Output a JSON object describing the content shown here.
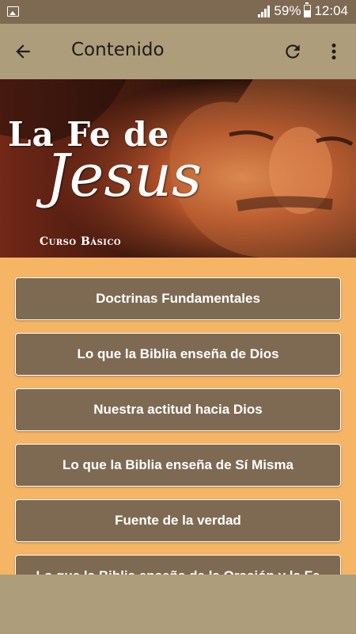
{
  "status_bar": {
    "battery": "59%",
    "time": "12:04"
  },
  "app_bar": {
    "title": "Contenido"
  },
  "banner": {
    "title_line1": "La Fe de",
    "title_line2": "Jesus",
    "subtitle": "Curso Básico"
  },
  "menu": {
    "items": [
      {
        "label": "Doctrinas Fundamentales"
      },
      {
        "label": "Lo que la Biblia enseña de Dios"
      },
      {
        "label": "Nuestra actitud hacia Dios"
      },
      {
        "label": "Lo que la Biblia enseña de Sí Misma"
      },
      {
        "label": "Fuente de la verdad"
      },
      {
        "label": "Lo que la Biblia enseña de la Oración y la Fe"
      }
    ]
  },
  "colors": {
    "status_bar": "#7e6a53",
    "app_bar": "#ae9d7a",
    "background": "#f5b565",
    "button": "#7e6a53"
  }
}
